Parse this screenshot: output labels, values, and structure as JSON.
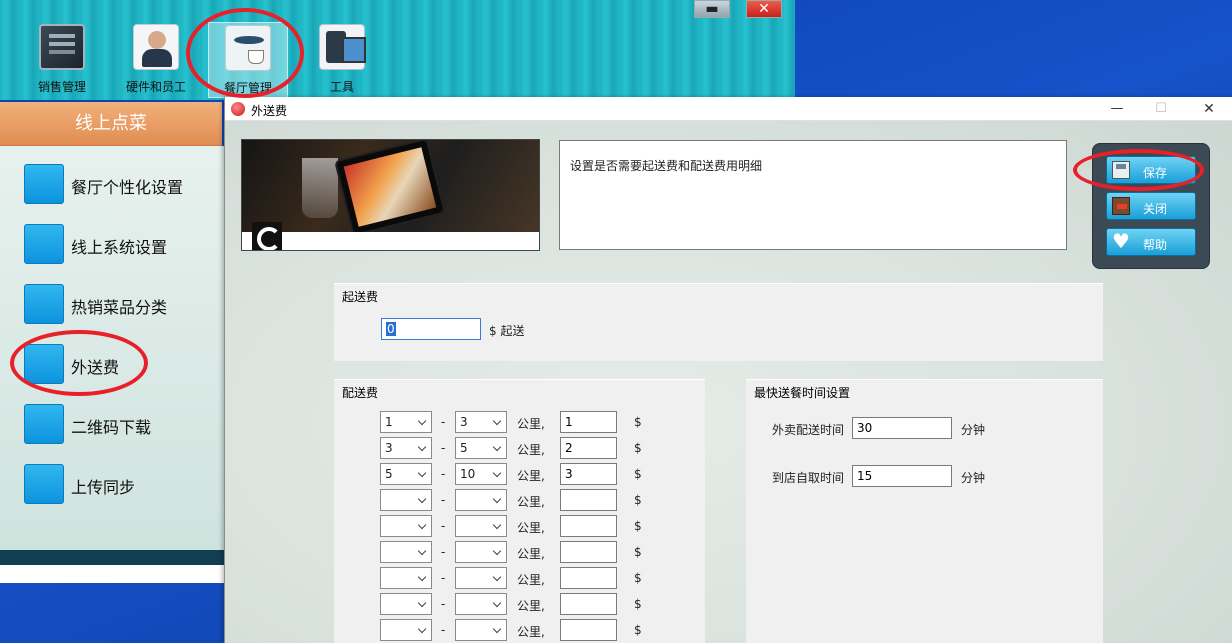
{
  "toolbar": {
    "items": [
      {
        "label": "销售管理",
        "icon": "ledger-book-icon"
      },
      {
        "label": "硬件和员工",
        "icon": "staff-chart-icon"
      },
      {
        "label": "餐厅管理",
        "icon": "cafe-table-icon"
      },
      {
        "label": "工具",
        "icon": "devices-icon"
      }
    ],
    "min_glyph": "▬",
    "close_glyph": "✕"
  },
  "sidebar": {
    "title": "线上点菜",
    "items": [
      {
        "label": "餐厅个性化设置"
      },
      {
        "label": "线上系统设置"
      },
      {
        "label": "热销菜品分类"
      },
      {
        "label": "外送费"
      },
      {
        "label": "二维码下载"
      },
      {
        "label": "上传同步"
      }
    ]
  },
  "dialog": {
    "title": "外送费",
    "min_glyph": "—",
    "max_glyph": "☐",
    "close_glyph": "✕",
    "description": "设置是否需要起送费和配送费用明细",
    "buttons": {
      "save": "保存",
      "close": "关闭",
      "help": "帮助"
    },
    "min_order": {
      "title": "起送费",
      "value": "0",
      "unit": "$ 起送"
    },
    "delivery_fee": {
      "title": "配送费",
      "dash": "-",
      "km_label": "公里,",
      "currency": "$",
      "rows": [
        {
          "from": "1",
          "to": "3",
          "fee": "1"
        },
        {
          "from": "3",
          "to": "5",
          "fee": "2"
        },
        {
          "from": "5",
          "to": "10",
          "fee": "3"
        },
        {
          "from": "",
          "to": "",
          "fee": ""
        },
        {
          "from": "",
          "to": "",
          "fee": ""
        },
        {
          "from": "",
          "to": "",
          "fee": ""
        },
        {
          "from": "",
          "to": "",
          "fee": ""
        },
        {
          "from": "",
          "to": "",
          "fee": ""
        },
        {
          "from": "",
          "to": "",
          "fee": ""
        }
      ]
    },
    "fastest_time": {
      "title": "最快送餐时间设置",
      "delivery_label": "外卖配送时间",
      "delivery_value": "30",
      "pickup_label": "到店自取时间",
      "pickup_value": "15",
      "unit": "分钟"
    }
  },
  "colors": {
    "accent_blue": "#1a9fd8",
    "annotation_red": "#e8202a",
    "sidebar_header": "#e08d50"
  }
}
